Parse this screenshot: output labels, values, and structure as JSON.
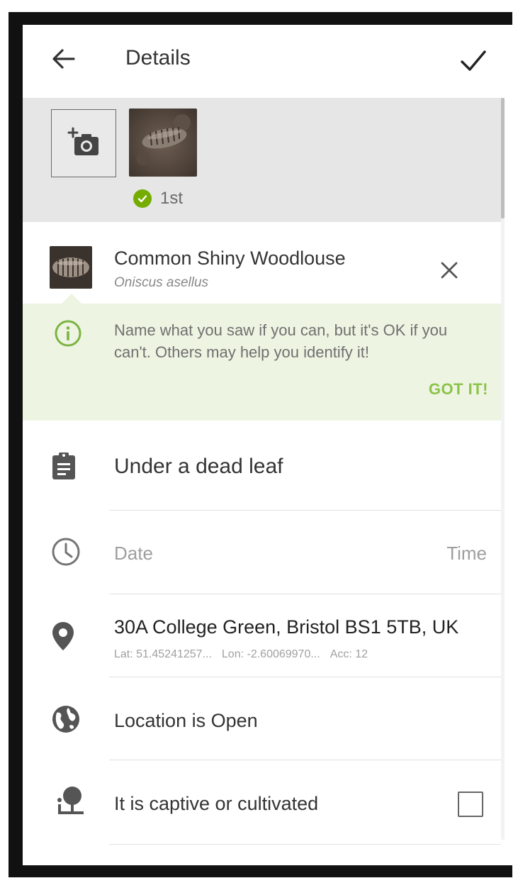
{
  "app_bar": {
    "title": "Details",
    "back_icon": "arrow-left-icon",
    "save_icon": "checkmark-icon"
  },
  "photos": {
    "add_photo_icon": "add-photo-camera-icon",
    "first_label": "1st",
    "first_badge_icon": "check-circle-icon",
    "badge_color": "#74ac00"
  },
  "taxon": {
    "common_name": "Common Shiny Woodlouse",
    "scientific_name": "Oniscus asellus",
    "remove_icon": "close-icon"
  },
  "tip": {
    "message": "Name what you saw if you can, but it's OK if you can't. Others may help you identify it!",
    "dismiss_label": "GOT IT!",
    "icon": "info-icon",
    "background": "#eef4e2",
    "accent": "#8bc34a"
  },
  "notes": {
    "value": "Under a dead leaf",
    "icon": "clipboard-icon"
  },
  "datetime": {
    "date_placeholder": "Date",
    "time_placeholder": "Time",
    "icon": "clock-icon"
  },
  "location": {
    "address": "30A College Green, Bristol BS1 5TB, UK",
    "lat": "Lat: 51.45241257...",
    "lon": "Lon: -2.60069970...",
    "acc": "Acc: 12",
    "icon": "map-pin-icon"
  },
  "geoprivacy": {
    "label": "Location is Open",
    "icon": "globe-icon"
  },
  "captive": {
    "label": "It is captive or cultivated",
    "checked": false,
    "icon": "captive-plant-icon"
  }
}
